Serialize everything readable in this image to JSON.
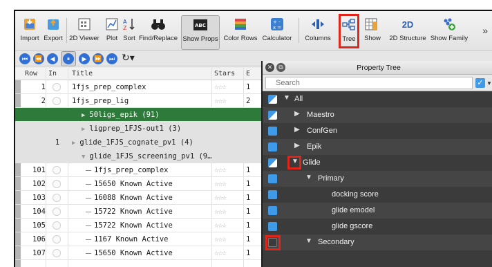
{
  "toolbar": {
    "buttons": [
      {
        "label": "Import",
        "icon": "import-icon"
      },
      {
        "label": "Export",
        "icon": "export-icon"
      },
      {
        "label": "2D Viewer",
        "icon": "viewer-2d-icon"
      },
      {
        "label": "Plot",
        "icon": "plot-icon"
      },
      {
        "label": "Sort",
        "icon": "sort-icon"
      },
      {
        "label": "Find/Replace",
        "icon": "binoculars-icon"
      },
      {
        "label": "Show Props",
        "icon": "abc-icon"
      },
      {
        "label": "Color Rows",
        "icon": "color-rows-icon"
      },
      {
        "label": "Calculator",
        "icon": "calculator-icon"
      },
      {
        "label": "Columns",
        "icon": "columns-icon"
      },
      {
        "label": "Tree",
        "icon": "tree-icon"
      },
      {
        "label": "Show",
        "icon": "show-icon"
      },
      {
        "label": "2D Structure",
        "icon": "2d-structure-icon",
        "icon_text": "2D"
      },
      {
        "label": "Show Family",
        "icon": "show-family-icon"
      }
    ],
    "more": "»"
  },
  "table": {
    "headers": {
      "row": "Row",
      "in": "In",
      "title": "Title",
      "stars": "Stars",
      "e": "E"
    },
    "rows": [
      {
        "row": "1",
        "in": "",
        "title": "1fjs_prep_complex",
        "stars": "☆☆☆",
        "e": "1"
      },
      {
        "row": "2",
        "in": "",
        "title": "1fjs_prep_lig",
        "stars": "☆☆☆",
        "e": "2"
      },
      {
        "row": "",
        "in": "",
        "title": "50ligs_epik (91)",
        "stars": "",
        "e": ""
      },
      {
        "row": "",
        "in": "",
        "title": "ligprep_1FJS-out1 (3)",
        "stars": "",
        "e": ""
      },
      {
        "row": "",
        "in": "1",
        "title": "glide_1FJS_cognate_pv1 (4)",
        "stars": "",
        "e": ""
      },
      {
        "row": "",
        "in": "",
        "title": "glide_1FJS_screening_pv1 (9…",
        "stars": "",
        "e": ""
      },
      {
        "row": "101",
        "in": "",
        "title": "1fjs_prep_complex",
        "stars": "☆☆☆",
        "e": "1"
      },
      {
        "row": "102",
        "in": "",
        "title": "15650 Known Active",
        "stars": "☆☆☆",
        "e": "1"
      },
      {
        "row": "103",
        "in": "",
        "title": "16088 Known Active",
        "stars": "☆☆☆",
        "e": "1"
      },
      {
        "row": "104",
        "in": "",
        "title": "15722 Known Active",
        "stars": "☆☆☆",
        "e": "1"
      },
      {
        "row": "105",
        "in": "",
        "title": "15722 Known Active",
        "stars": "☆☆☆",
        "e": "1"
      },
      {
        "row": "106",
        "in": "",
        "title": "1167 Known Active",
        "stars": "☆☆☆",
        "e": "1"
      },
      {
        "row": "107",
        "in": "",
        "title": "15650 Known Active",
        "stars": "☆☆☆",
        "e": "1"
      }
    ]
  },
  "property_tree": {
    "title": "Property Tree",
    "search_placeholder": "Search",
    "items": [
      {
        "label": "All",
        "state": "partial"
      },
      {
        "label": "Maestro",
        "state": "partial"
      },
      {
        "label": "ConfGen",
        "state": "checked"
      },
      {
        "label": "Epik",
        "state": "checked"
      },
      {
        "label": "Glide",
        "state": "partial"
      },
      {
        "label": "Primary",
        "state": "checked"
      },
      {
        "label": "docking score",
        "state": "checked"
      },
      {
        "label": "glide emodel",
        "state": "checked"
      },
      {
        "label": "glide gscore",
        "state": "checked"
      },
      {
        "label": "Secondary",
        "state": "unchecked"
      }
    ]
  },
  "colors": {
    "highlight": "#e0261b",
    "selected_row": "#2d7a3a",
    "checkbox": "#3f9ae8",
    "tree_bg": "#3b3b3b"
  }
}
